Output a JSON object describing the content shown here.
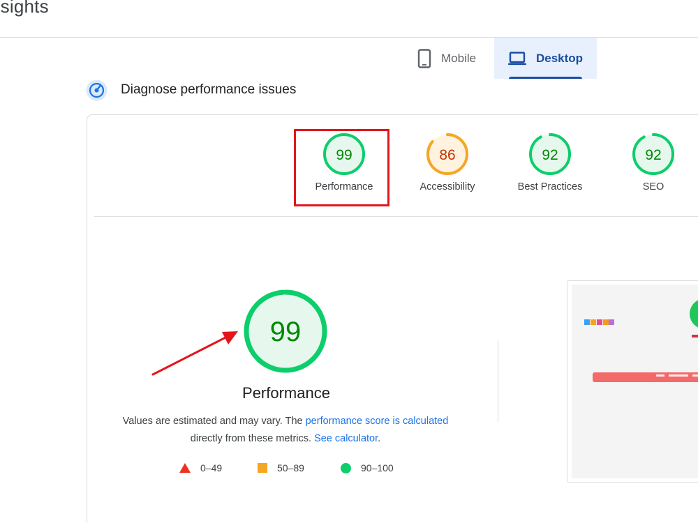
{
  "header": {
    "title": "nsights"
  },
  "tabs": [
    {
      "label": "Mobile",
      "icon": "phone-icon",
      "selected": false
    },
    {
      "label": "Desktop",
      "icon": "laptop-icon",
      "selected": true
    }
  ],
  "diagnose": {
    "title": "Diagnose performance issues",
    "icon": "gauge-icon"
  },
  "categories": [
    {
      "label": "Performance",
      "score": "99",
      "status": "pass"
    },
    {
      "label": "Accessibility",
      "score": "86",
      "status": "average"
    },
    {
      "label": "Best Practices",
      "score": "92",
      "status": "pass"
    },
    {
      "label": "SEO",
      "score": "92",
      "status": "pass"
    }
  ],
  "main_score": {
    "score": "99",
    "label": "Performance",
    "desc_1": "Values are estimated and may vary. The ",
    "link_1": "performance score is calculated",
    "desc_2": "directly from these metrics. ",
    "link_2": "See calculator",
    "desc_3": "."
  },
  "legend": [
    {
      "range": "0–49",
      "shape": "triangle",
      "color": "#eb3223"
    },
    {
      "range": "50–89",
      "shape": "square",
      "color": "#f5a623"
    },
    {
      "range": "90–100",
      "shape": "circle",
      "color": "#0cce6b"
    }
  ],
  "colors": {
    "pass": "#0cce6b",
    "pass_fill": "#e6f8ee",
    "pass_text": "#008800",
    "average": "#f5a623",
    "average_fill": "#fff3e0",
    "average_text": "#c33300",
    "accent": "#1a4ea0",
    "highlight": "#e3151a"
  }
}
